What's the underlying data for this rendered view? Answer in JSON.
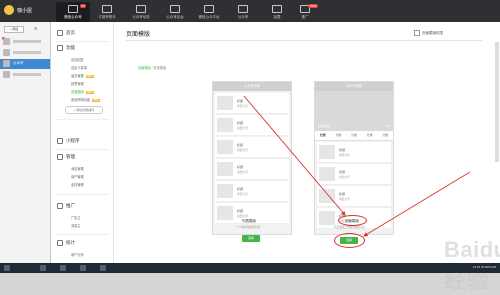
{
  "app": {
    "name": "咖小屋"
  },
  "topnav": [
    {
      "label": "微信公众号",
      "active": true,
      "badge": "10"
    },
    {
      "label": "订阅号助手",
      "active": false
    },
    {
      "label": "公众号动态",
      "active": false
    },
    {
      "label": "公众号后台",
      "active": false
    },
    {
      "label": "微信公众平台",
      "active": false
    },
    {
      "label": "公众号",
      "active": false
    },
    {
      "label": "加载",
      "active": false
    },
    {
      "label": "推广",
      "active": false,
      "badge": "NEW"
    }
  ],
  "accounts": {
    "add_label": "+ 添加",
    "selected_name": "公众号"
  },
  "sidebar": {
    "home": "首页",
    "function": {
      "title": "功能",
      "items": [
        {
          "label": "自动回复",
          "active": false
        },
        {
          "label": "自定义菜单",
          "active": false
        },
        {
          "label": "留言管理",
          "active": false,
          "tag": "NEW"
        },
        {
          "label": "投票管理",
          "active": false
        },
        {
          "label": "页面模版",
          "active": true,
          "tag": "NEW"
        },
        {
          "label": "原创声明功能",
          "active": false,
          "tag": "NEW"
        }
      ],
      "add_plugin": "+ 添加功能插件"
    },
    "mini_program": "小程序",
    "manage": {
      "title": "管理",
      "items": [
        "消息管理",
        "用户管理",
        "素材管理"
      ]
    },
    "promote": {
      "title": "推广",
      "items": [
        "广告主",
        "流量主"
      ]
    },
    "stats": {
      "title": "统计",
      "items": [
        "用户分析"
      ]
    }
  },
  "main": {
    "title": "页面模版",
    "top_right": "页面模版权限",
    "breadcrumb": {
      "link": "页面模版",
      "current": "/ 选择模版"
    },
    "templates": [
      {
        "header": "公众号名称",
        "items": [
          {
            "title": "标题",
            "desc": "摘要文字"
          },
          {
            "title": "标题",
            "desc": "摘要文字"
          },
          {
            "title": "标题",
            "desc": "摘要文字"
          },
          {
            "title": "标题",
            "desc": "摘要文字"
          },
          {
            "title": "标题",
            "desc": "摘要文字"
          },
          {
            "title": "标题",
            "desc": "摘要文字"
          }
        ],
        "name": "列表模版",
        "desc": "一个简单的模版列表",
        "button": "选择"
      },
      {
        "header": "公众号名称",
        "cover_title": "封面标题",
        "cover_dots": "● ●",
        "tabs": [
          "分类",
          "分类",
          "分类",
          "分类",
          "分类"
        ],
        "items": [
          {
            "title": "标题",
            "desc": "摘要文字"
          },
          {
            "title": "标题",
            "desc": "摘要文字"
          },
          {
            "title": "标题",
            "desc": "摘要文字"
          },
          {
            "title": "标题",
            "desc": "摘要文字"
          }
        ],
        "name": "封面模版",
        "desc": "有封面和分类的模版列表",
        "button": "选择"
      }
    ]
  },
  "taskbar": {
    "clock": "14:18 2018/01/08"
  },
  "watermark": "Baidu 经验",
  "colors": {
    "accent": "#44b549",
    "highlight": "#d9312b",
    "topbar": "#2e3034"
  }
}
